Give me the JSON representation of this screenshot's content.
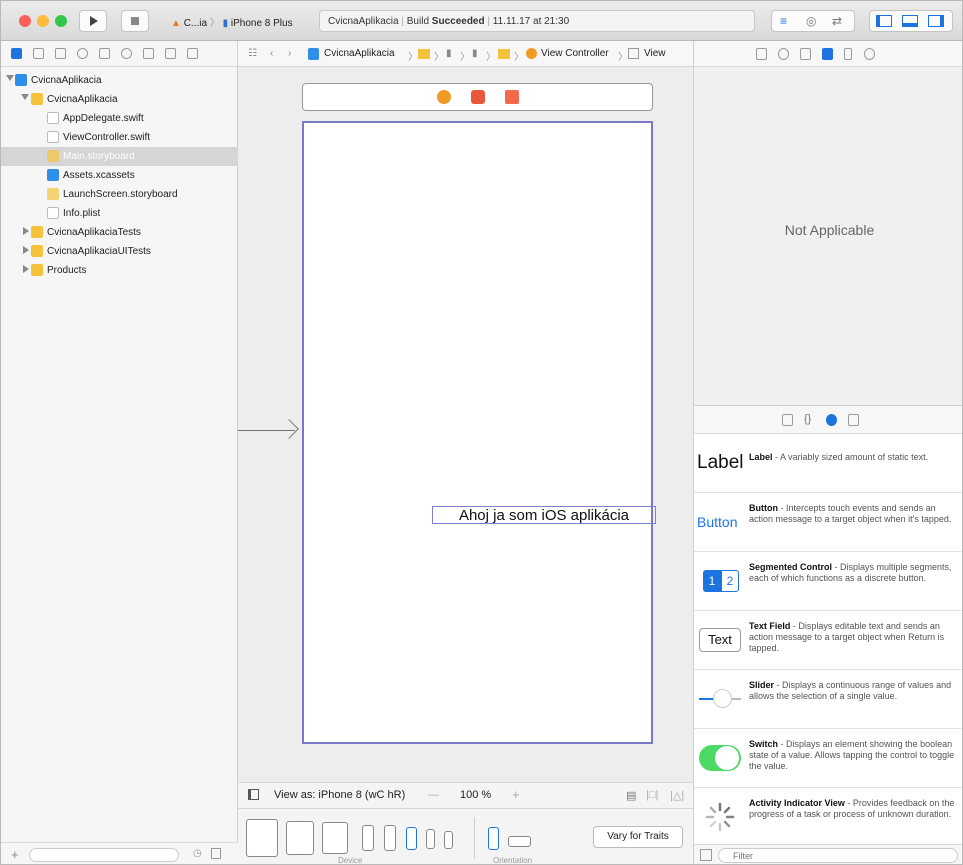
{
  "toolbar": {
    "scheme_app": "C...ia",
    "scheme_device": "iPhone 8 Plus",
    "status_project": "CvicnaAplikacia",
    "status_build_prefix": "Build",
    "status_build_result": "Succeeded",
    "status_time": "11.11.17 at 21:30"
  },
  "navigator": {
    "items": [
      {
        "label": "CvicnaAplikacia"
      },
      {
        "label": "CvicnaAplikacia"
      },
      {
        "label": "AppDelegate.swift"
      },
      {
        "label": "ViewController.swift"
      },
      {
        "label": "Main.storyboard"
      },
      {
        "label": "Assets.xcassets"
      },
      {
        "label": "LaunchScreen.storyboard"
      },
      {
        "label": "Info.plist"
      },
      {
        "label": "CvicnaAplikaciaTests"
      },
      {
        "label": "CvicnaAplikaciaUITests"
      },
      {
        "label": "Products"
      }
    ]
  },
  "editor": {
    "breadcrumb_project": "CvicnaAplikacia",
    "breadcrumb_vc": "View Controller",
    "breadcrumb_view": "View",
    "label_text": "Ahoj ja som iOS aplikácia",
    "view_as": "View as: iPhone 8 (wC hR)",
    "zoom": "100 %",
    "vary_button": "Vary for Traits",
    "device_caption": "Device",
    "orientation_caption": "Orientation"
  },
  "inspector": {
    "not_applicable": "Not Applicable",
    "library": [
      {
        "preview": "Label",
        "title": "Label",
        "text": " - A variably sized amount of static text."
      },
      {
        "preview": "Button",
        "title": "Button",
        "text": " - Intercepts touch events and sends an action message to a target object when it's tapped."
      },
      {
        "preview": "1 2",
        "title": "Segmented Control",
        "text": " - Displays multiple segments, each of which functions as a discrete button."
      },
      {
        "preview": "Text",
        "title": "Text Field",
        "text": " - Displays editable text and sends an action message to a target object when Return is tapped."
      },
      {
        "preview": "",
        "title": "Slider",
        "text": " - Displays a continuous range of values and allows the selection of a single value."
      },
      {
        "preview": "",
        "title": "Switch",
        "text": " - Displays an element showing the boolean state of a value. Allows tapping the control to toggle the value."
      },
      {
        "preview": "",
        "title": "Activity Indicator View",
        "text": " - Provides feedback on the progress of a task or process of unknown duration."
      }
    ],
    "filter_placeholder": "Filter"
  },
  "colors": {
    "accent": "#1d74e0",
    "scene_border": "#7b78c6",
    "folder": "#f5c33b",
    "switch_on": "#4cd964"
  }
}
